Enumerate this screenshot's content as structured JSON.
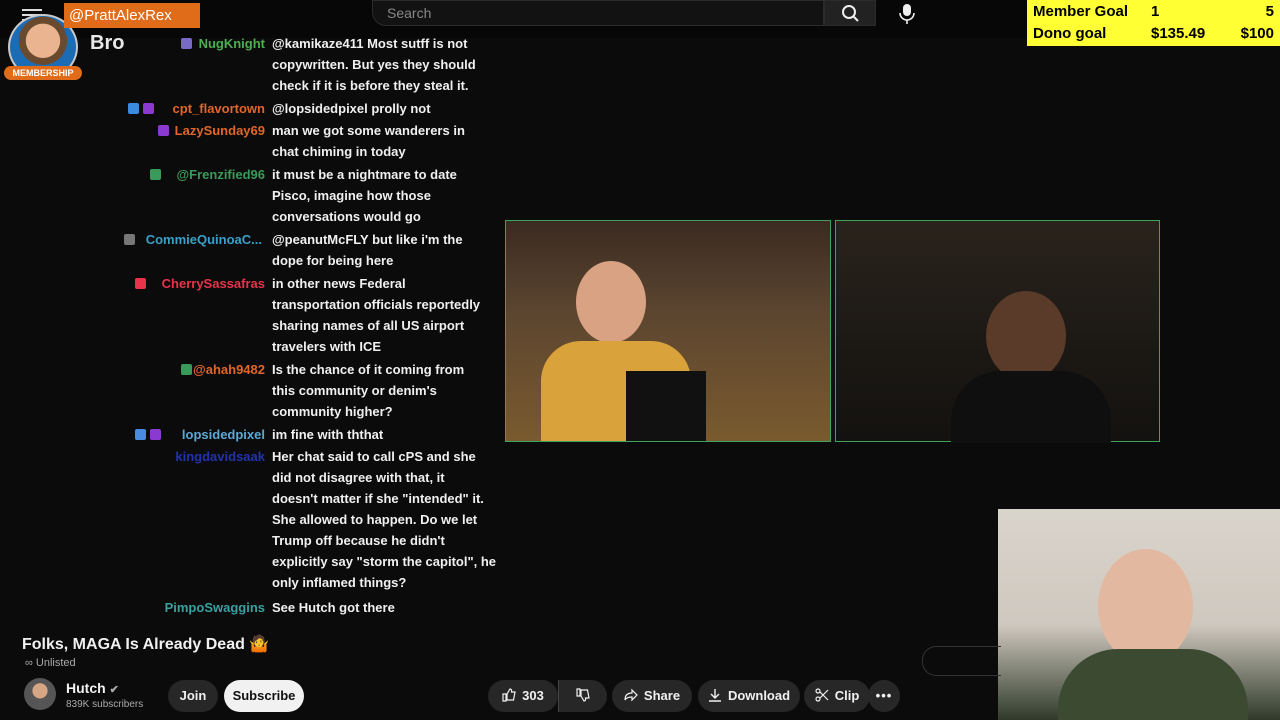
{
  "overlay": {
    "handle": "@PrattAlexRex",
    "membership_badge": "MEMBERSHIP",
    "bro_label": "Bro"
  },
  "search": {
    "placeholder": "Search"
  },
  "goals": {
    "member_goal": {
      "label": "Member Goal",
      "current": "1",
      "target": "5"
    },
    "dono_goal": {
      "label": "Dono goal",
      "current": "$135.49",
      "target": "$100"
    }
  },
  "chat": [
    {
      "user": "NugKnight",
      "color": "#4caf50",
      "lines": [
        "@kamikaze411 Most sutff is not",
        "copywritten. But yes they should",
        "check if it is before they steal it."
      ]
    },
    {
      "user": "cpt_flavortown",
      "color": "#e0662a",
      "lines": [
        "@lopsidedpixel prolly not"
      ]
    },
    {
      "user": "LazySunday69",
      "color": "#e0662a",
      "lines": [
        "man we got some wanderers in",
        "chat chiming in today"
      ]
    },
    {
      "user": "@Frenzified96",
      "color": "#3a9a5a",
      "lines": [
        "it must be a nightmare to date",
        "Pisco, imagine how those",
        "conversations would go"
      ]
    },
    {
      "user": "CommieQuinoaC...",
      "color": "#3aa0c8",
      "lines": [
        "@peanutMcFLY but like i'm the",
        "dope for being here"
      ]
    },
    {
      "user": "CherrySassafras",
      "color": "#e8334a",
      "lines": [
        "in other news Federal",
        "transportation officials reportedly",
        "sharing names of all US airport",
        "travelers with ICE"
      ]
    },
    {
      "user": "@ahah9482",
      "color": "#e0662a",
      "lines": [
        "Is the chance of it coming from",
        "this community or denim's",
        "community higher?"
      ]
    },
    {
      "user": "lopsidedpixel",
      "color": "#5aa9d6",
      "lines": [
        "im fine with ththat"
      ]
    },
    {
      "user": "kingdavidsaak",
      "color": "#2233aa",
      "lines": [
        "Her chat said to call cPS and she",
        "did not disagree with that, it",
        "doesn't matter if she \"intended\" it.",
        "She allowed to happen. Do we let",
        "Trump off because he didn't",
        "explicitly say \"storm the capitol\", he",
        "only inflamed things?"
      ]
    },
    {
      "user": "PimpoSwaggins",
      "color": "#3aa0a0",
      "lines": [
        "See Hutch got there"
      ]
    }
  ],
  "video": {
    "title": "Folks, MAGA Is Already Dead",
    "visibility": "Unlisted"
  },
  "channel": {
    "name": "Hutch",
    "subscribers": "839K subscribers",
    "join_label": "Join",
    "subscribe_label": "Subscribe"
  },
  "actions": {
    "likes": "303",
    "share_label": "Share",
    "download_label": "Download",
    "clip_label": "Clip"
  },
  "colors": {
    "goal_bg": "#ffff33",
    "handle_bg": "#e06c1a",
    "cam_border": "#3ea35a"
  }
}
